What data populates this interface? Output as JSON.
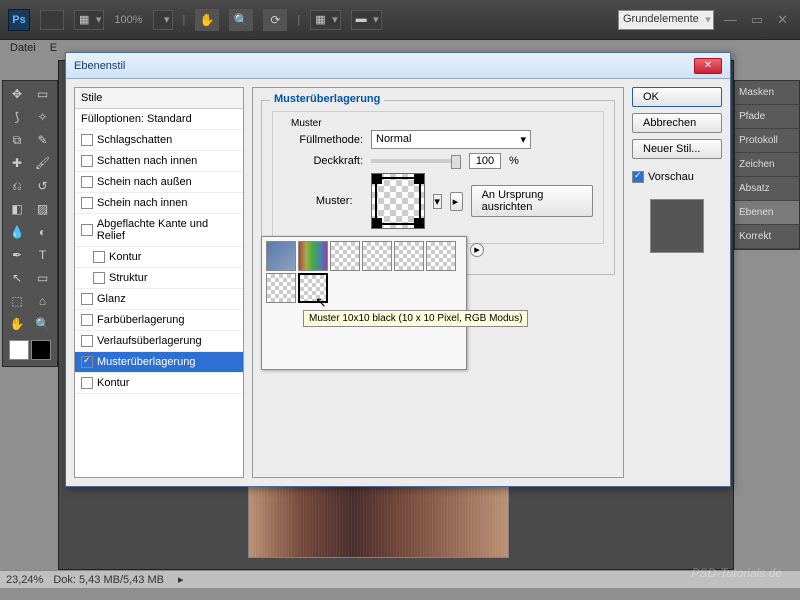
{
  "app": {
    "icon": "Ps",
    "zoom_label": "100%",
    "workspace": "Grundelemente"
  },
  "menubar": {
    "file": "Datei",
    "edit_fragment": "E"
  },
  "right_panels": [
    "Masken",
    "Pfade",
    "Protokoll",
    "Zeichen",
    "Absatz",
    "Ebenen",
    "Korrekt"
  ],
  "statusbar": {
    "zoom": "23,24%",
    "doc": "Dok: 5,43 MB/5,43 MB"
  },
  "dialog": {
    "title": "Ebenenstil",
    "styles_header": "Stile",
    "fill_options": "Fülloptionen: Standard",
    "items": [
      "Schlagschatten",
      "Schatten nach innen",
      "Schein nach außen",
      "Schein nach innen",
      "Abgeflachte Kante und Relief",
      "Kontur",
      "Struktur",
      "Glanz",
      "Farbüberlagerung",
      "Verlaufsüberlagerung",
      "Musterüberlagerung",
      "Kontur"
    ],
    "panel": {
      "title": "Musterüberlagerung",
      "sub": "Muster",
      "blend_label": "Füllmethode:",
      "blend_value": "Normal",
      "opacity_label": "Deckkraft:",
      "opacity_value": "100",
      "pct": "%",
      "pattern_label": "Muster:",
      "snap_btn": "An Ursprung ausrichten"
    },
    "tooltip": "Muster 10x10 black (10 x 10 Pixel, RGB Modus)",
    "ok": "OK",
    "cancel": "Abbrechen",
    "new_style": "Neuer Stil...",
    "preview_chk": "Vorschau"
  },
  "watermark": "PSD-Tutorials.de"
}
